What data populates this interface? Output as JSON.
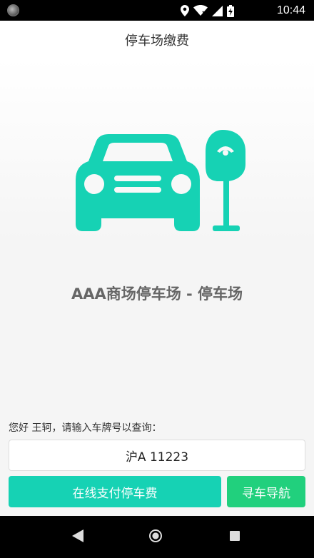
{
  "status_bar": {
    "time": "10:44",
    "icons": [
      "location-icon",
      "wifi-icon",
      "signal-icon",
      "battery-charging-icon"
    ]
  },
  "app_bar": {
    "title": "停车场缴费"
  },
  "lot": {
    "name": "AAA商场停车场 - 停车场"
  },
  "form": {
    "greeting": "您好 王轲，请输入车牌号以查询：",
    "plate_value": "沪A 11223",
    "pay_button": "在线支付停车费",
    "nav_button": "寻车导航"
  },
  "colors": {
    "accent": "#16d2b4",
    "nav_button": "#21d07d"
  }
}
